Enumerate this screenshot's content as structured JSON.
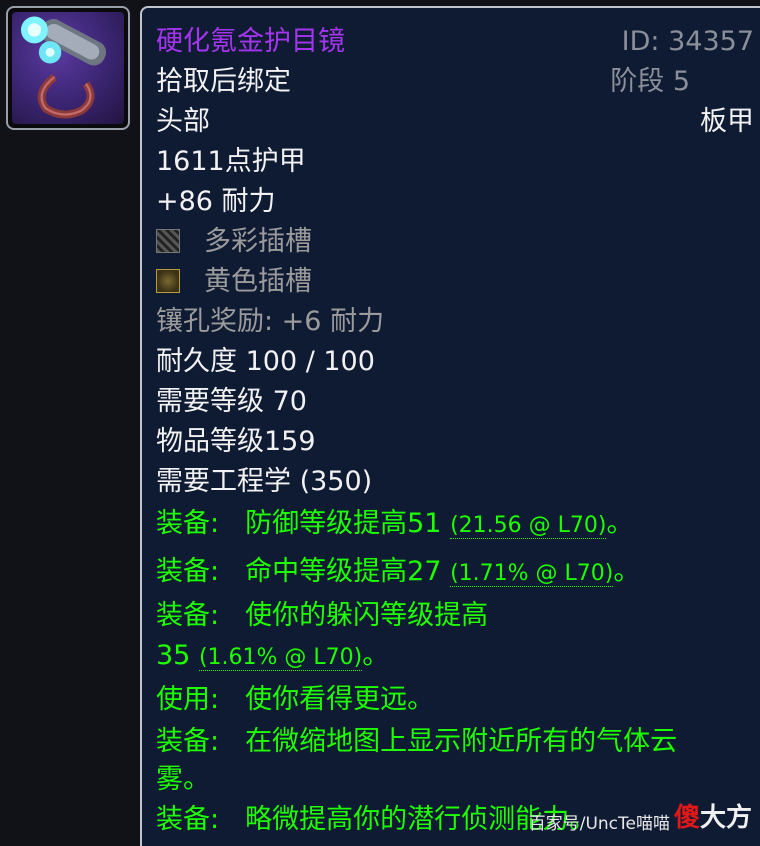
{
  "item": {
    "name": "硬化氪金护目镜",
    "id_label": "ID: 34357",
    "binding": "拾取后绑定",
    "phase": "阶段 5",
    "slot": "头部",
    "armor_type": "板甲",
    "armor": "1611点护甲",
    "stamina": "+86 耐力",
    "socket_meta": "多彩插槽",
    "socket_yellow": "黄色插槽",
    "socket_bonus": "镶孔奖励: +6 耐力",
    "durability": "耐久度 100 / 100",
    "req_level": "需要等级 70",
    "item_level": "物品等级159",
    "req_skill": "需要工程学 (350)"
  },
  "effects": {
    "e1_prefix": "装备:",
    "e1_text": "防御等级提高51",
    "e1_detail": "(21.56 @ L70)",
    "e1_end": "。",
    "e2_prefix": "装备:",
    "e2_text": "命中等级提高27",
    "e2_detail": "(1.71% @ L70)",
    "e2_end": "。",
    "e3_prefix": "装备:",
    "e3_text": "使你的躲闪等级提高",
    "e3_cont": "35",
    "e3_detail": "(1.61% @ L70)",
    "e3_end": "。",
    "e4_prefix": "使用:",
    "e4_text": "使你看得更远。",
    "e5_prefix": "装备:",
    "e5_text": "在微缩地图上显示附近所有的气体云",
    "e5_cont": "雾。",
    "e6_prefix": "装备:",
    "e6_text": "略微提高你的潜行侦测能力。"
  },
  "watermark": {
    "text": "百家号/UncTe喵喵",
    "brand_red": "傻",
    "brand_rest": "大方"
  },
  "colors": {
    "epic_purple": "#a335ee",
    "effect_green": "#1eff00",
    "panel_bg": "#0f1a33"
  },
  "icons": [
    "goggles-item-icon",
    "meta-socket-icon",
    "yellow-socket-icon"
  ]
}
